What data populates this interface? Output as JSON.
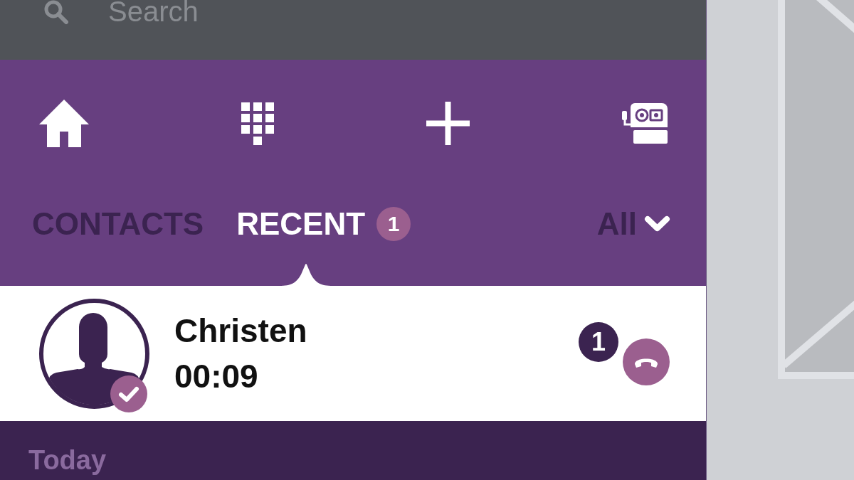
{
  "search": {
    "placeholder": "Search"
  },
  "tabs": [
    {
      "label": "CONTACTS",
      "selected": false
    },
    {
      "label": "RECENT",
      "selected": true,
      "badge": "1"
    }
  ],
  "filter": {
    "label": "All"
  },
  "calls": [
    {
      "name": "Christen",
      "duration": "00:09",
      "unread": "1"
    }
  ],
  "section": {
    "label": "Today"
  }
}
